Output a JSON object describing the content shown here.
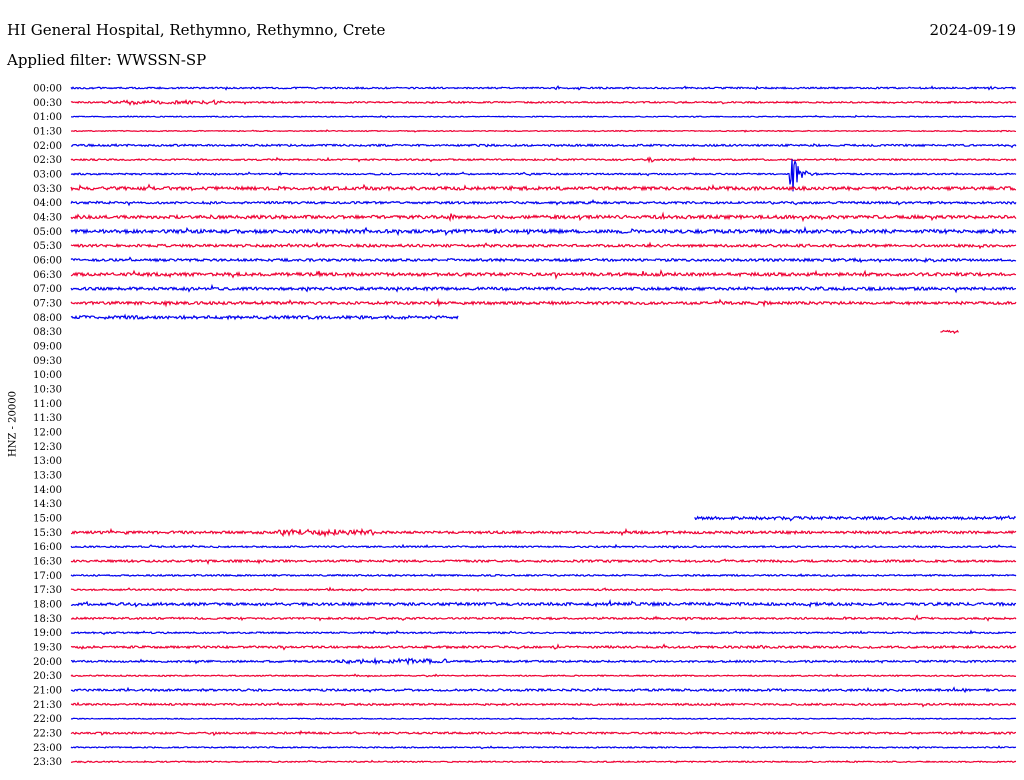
{
  "header": {
    "station": "HI General Hospital, Rethymno, Rethymno, Crete",
    "date": "2024-09-19",
    "filter": "Applied filter: WWSSN-SP"
  },
  "chart_data": {
    "type": "line",
    "title": "HI General Hospital, Rethymno, Rethymno, Crete",
    "ylabel": "HNZ - 20000",
    "colors": [
      "#0000ee",
      "#ee0033"
    ],
    "row_labels": [
      "00:00",
      "00:30",
      "01:00",
      "01:30",
      "02:00",
      "02:30",
      "03:00",
      "03:30",
      "04:00",
      "04:30",
      "05:00",
      "05:30",
      "06:00",
      "06:30",
      "07:00",
      "07:30",
      "08:00",
      "08:30",
      "09:00",
      "09:30",
      "10:00",
      "10:30",
      "11:00",
      "11:30",
      "12:00",
      "12:30",
      "13:00",
      "13:30",
      "14:00",
      "14:30",
      "15:00",
      "15:30",
      "16:00",
      "16:30",
      "17:00",
      "17:30",
      "18:00",
      "18:30",
      "19:00",
      "19:30",
      "20:00",
      "20:30",
      "21:00",
      "21:30",
      "22:00",
      "22:30",
      "23:00",
      "23:30"
    ],
    "series": [
      {
        "time": "00:00",
        "color": "#0000ee",
        "start": 0,
        "end": 1,
        "noise": 1,
        "bursts": [
          [
            0.51,
            1.5
          ],
          [
            0.72,
            1.5
          ],
          [
            0.97,
            1.5
          ]
        ]
      },
      {
        "time": "00:30",
        "color": "#ee0033",
        "start": 0,
        "end": 1,
        "noise": 1,
        "bursts": [
          [
            0.04,
            1.6,
            0.12
          ]
        ]
      },
      {
        "time": "01:00",
        "color": "#0000ee",
        "start": 0,
        "end": 1,
        "noise": 0.6,
        "bursts": []
      },
      {
        "time": "01:30",
        "color": "#ee0033",
        "start": 0,
        "end": 1,
        "noise": 0.6,
        "bursts": []
      },
      {
        "time": "02:00",
        "color": "#0000ee",
        "start": 0,
        "end": 1,
        "noise": 1.2,
        "bursts": []
      },
      {
        "time": "02:30",
        "color": "#ee0033",
        "start": 0,
        "end": 1,
        "noise": 1,
        "bursts": [
          [
            0.61,
            2
          ]
        ]
      },
      {
        "time": "03:00",
        "color": "#0000ee",
        "start": 0,
        "end": 1,
        "noise": 1,
        "quake": [
          0.76,
          30
        ]
      },
      {
        "time": "03:30",
        "color": "#ee0033",
        "start": 0,
        "end": 1,
        "noise": 2,
        "bursts": []
      },
      {
        "time": "04:00",
        "color": "#0000ee",
        "start": 0,
        "end": 1,
        "noise": 1.4,
        "bursts": []
      },
      {
        "time": "04:30",
        "color": "#ee0033",
        "start": 0,
        "end": 1,
        "noise": 2,
        "bursts": [
          [
            0.4,
            3
          ]
        ]
      },
      {
        "time": "05:00",
        "color": "#0000ee",
        "start": 0,
        "end": 1,
        "noise": 2.2,
        "bursts": []
      },
      {
        "time": "05:30",
        "color": "#ee0033",
        "start": 0,
        "end": 1,
        "noise": 1.6,
        "bursts": []
      },
      {
        "time": "06:00",
        "color": "#0000ee",
        "start": 0,
        "end": 1,
        "noise": 1.6,
        "bursts": []
      },
      {
        "time": "06:30",
        "color": "#ee0033",
        "start": 0,
        "end": 1,
        "noise": 2,
        "bursts": [
          [
            0.1,
            3
          ]
        ]
      },
      {
        "time": "07:00",
        "color": "#0000ee",
        "start": 0,
        "end": 1,
        "noise": 1.8,
        "bursts": []
      },
      {
        "time": "07:30",
        "color": "#ee0033",
        "start": 0,
        "end": 1,
        "noise": 1.8,
        "bursts": []
      },
      {
        "time": "08:00",
        "color": "#0000ee",
        "start": 0,
        "end": 0.41,
        "noise": 2,
        "bursts": []
      },
      {
        "time": "08:30",
        "color": "#ee0033",
        "start": 0.92,
        "end": 0.94,
        "noise": 1.5,
        "bursts": []
      },
      {
        "time": "15:00",
        "color": "#0000ee",
        "start": 0.66,
        "end": 1,
        "noise": 1.8,
        "bursts": []
      },
      {
        "time": "15:30",
        "color": "#ee0033",
        "start": 0,
        "end": 1,
        "noise": 1.6,
        "bursts": [
          [
            0.22,
            2.5,
            0.1
          ]
        ]
      },
      {
        "time": "16:00",
        "color": "#0000ee",
        "start": 0,
        "end": 1,
        "noise": 1,
        "bursts": []
      },
      {
        "time": "16:30",
        "color": "#ee0033",
        "start": 0,
        "end": 1,
        "noise": 1.4,
        "bursts": []
      },
      {
        "time": "17:00",
        "color": "#0000ee",
        "start": 0,
        "end": 1,
        "noise": 1,
        "bursts": []
      },
      {
        "time": "17:30",
        "color": "#ee0033",
        "start": 0,
        "end": 1,
        "noise": 1,
        "bursts": [
          [
            0.27,
            2.5
          ]
        ]
      },
      {
        "time": "18:00",
        "color": "#0000ee",
        "start": 0,
        "end": 1,
        "noise": 1.8,
        "bursts": []
      },
      {
        "time": "18:30",
        "color": "#ee0033",
        "start": 0,
        "end": 1,
        "noise": 1.2,
        "bursts": [
          [
            0.89,
            2.5
          ]
        ]
      },
      {
        "time": "19:00",
        "color": "#0000ee",
        "start": 0,
        "end": 1,
        "noise": 1,
        "bursts": []
      },
      {
        "time": "19:30",
        "color": "#ee0033",
        "start": 0,
        "end": 1,
        "noise": 1.4,
        "bursts": [
          [
            0.73,
            2.5
          ]
        ]
      },
      {
        "time": "20:00",
        "color": "#0000ee",
        "start": 0,
        "end": 1,
        "noise": 1.2,
        "bursts": [
          [
            0.28,
            2,
            0.12
          ]
        ]
      },
      {
        "time": "20:30",
        "color": "#ee0033",
        "start": 0,
        "end": 1,
        "noise": 0.8,
        "bursts": []
      },
      {
        "time": "21:00",
        "color": "#0000ee",
        "start": 0,
        "end": 1,
        "noise": 1.4,
        "bursts": []
      },
      {
        "time": "21:30",
        "color": "#ee0033",
        "start": 0,
        "end": 1,
        "noise": 1.2,
        "bursts": []
      },
      {
        "time": "22:00",
        "color": "#0000ee",
        "start": 0,
        "end": 1,
        "noise": 0.6,
        "bursts": []
      },
      {
        "time": "22:30",
        "color": "#ee0033",
        "start": 0,
        "end": 1,
        "noise": 1.2,
        "bursts": []
      },
      {
        "time": "23:00",
        "color": "#0000ee",
        "start": 0,
        "end": 1,
        "noise": 0.8,
        "bursts": []
      },
      {
        "time": "23:30",
        "color": "#ee0033",
        "start": 0,
        "end": 1,
        "noise": 0.8,
        "bursts": []
      }
    ]
  }
}
